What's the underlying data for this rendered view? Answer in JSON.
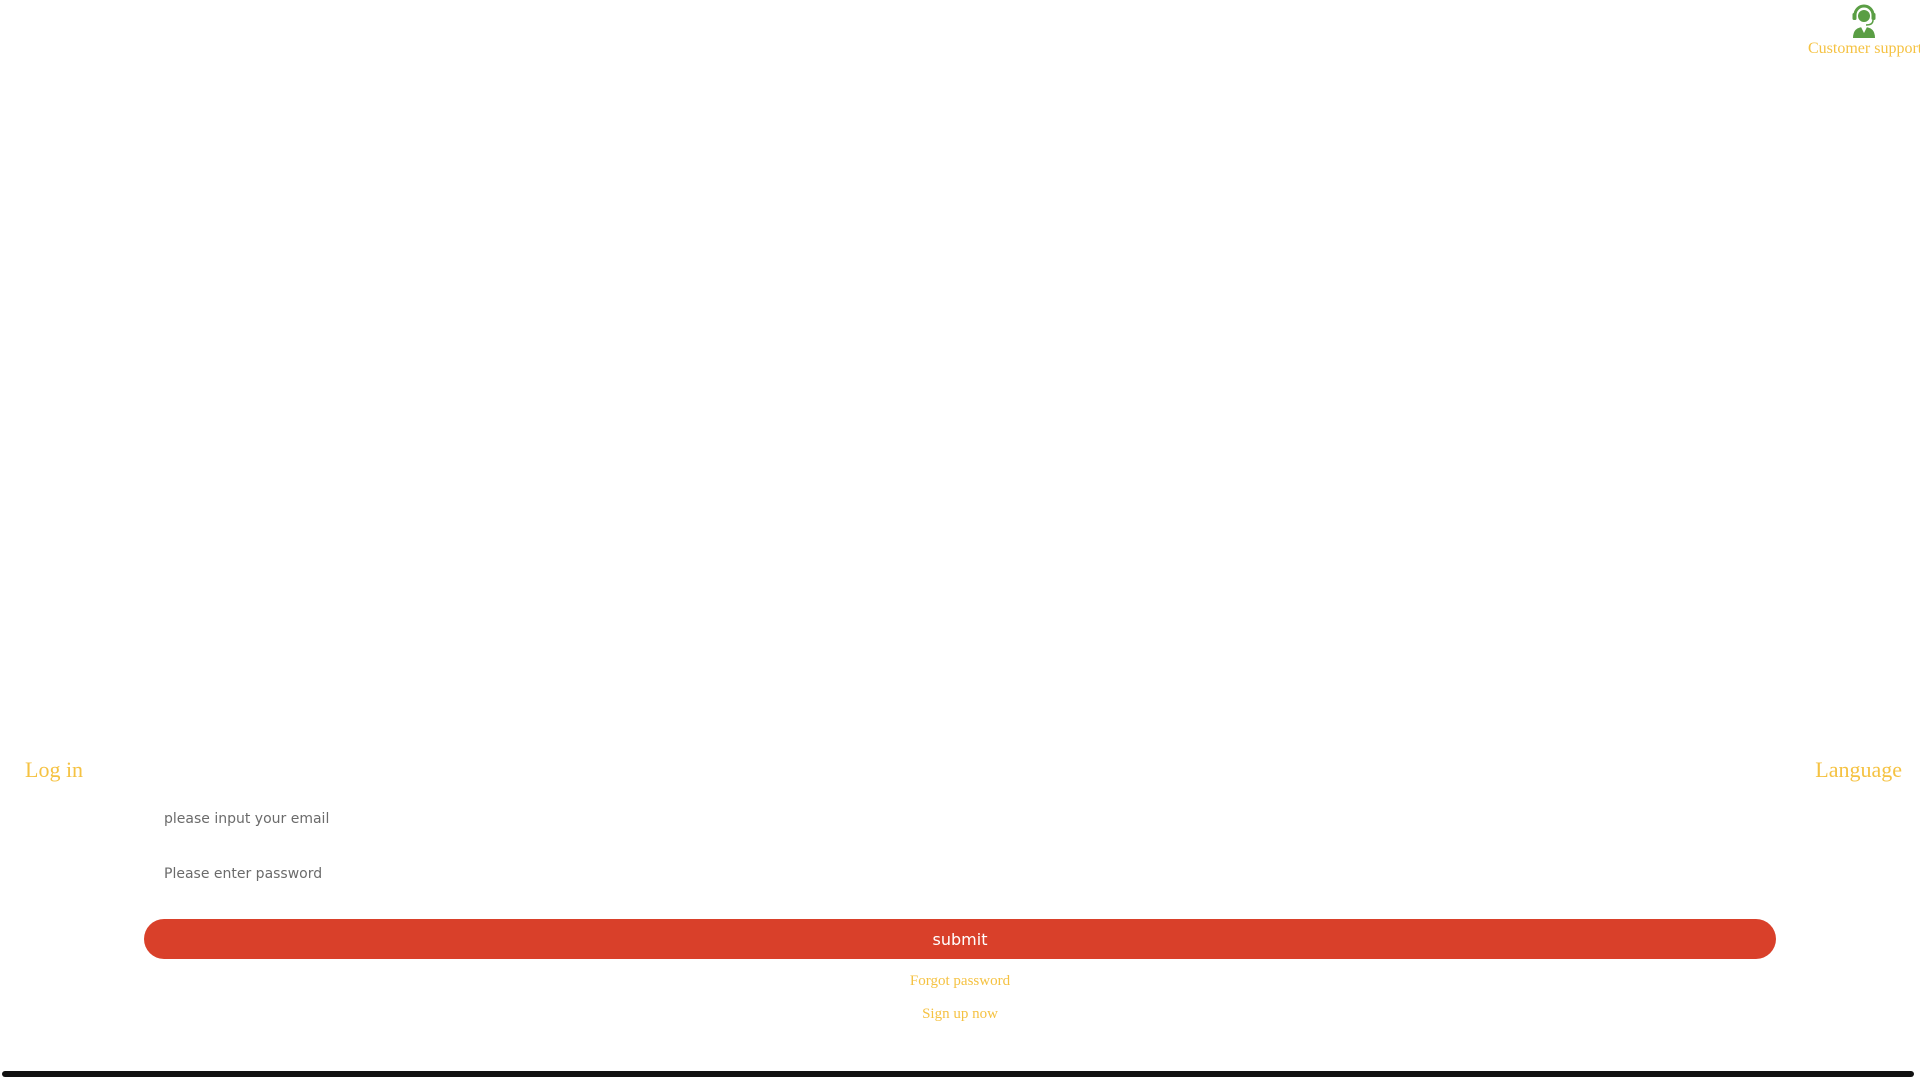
{
  "support": {
    "label": "Customer support",
    "icon": "customer-support-icon",
    "icon_color": "#5a9e44"
  },
  "login": {
    "title": "Log in",
    "language_label": "Language",
    "email_placeholder": "please input your email",
    "email_value": "",
    "password_placeholder": "Please enter password",
    "password_value": "",
    "submit_label": "submit",
    "forgot_label": "Forgot password",
    "signup_label": "Sign up now"
  },
  "colors": {
    "accent": "#f5c242",
    "button": "#d9402a",
    "button_text": "#ffffff",
    "background": "#ffffff"
  }
}
